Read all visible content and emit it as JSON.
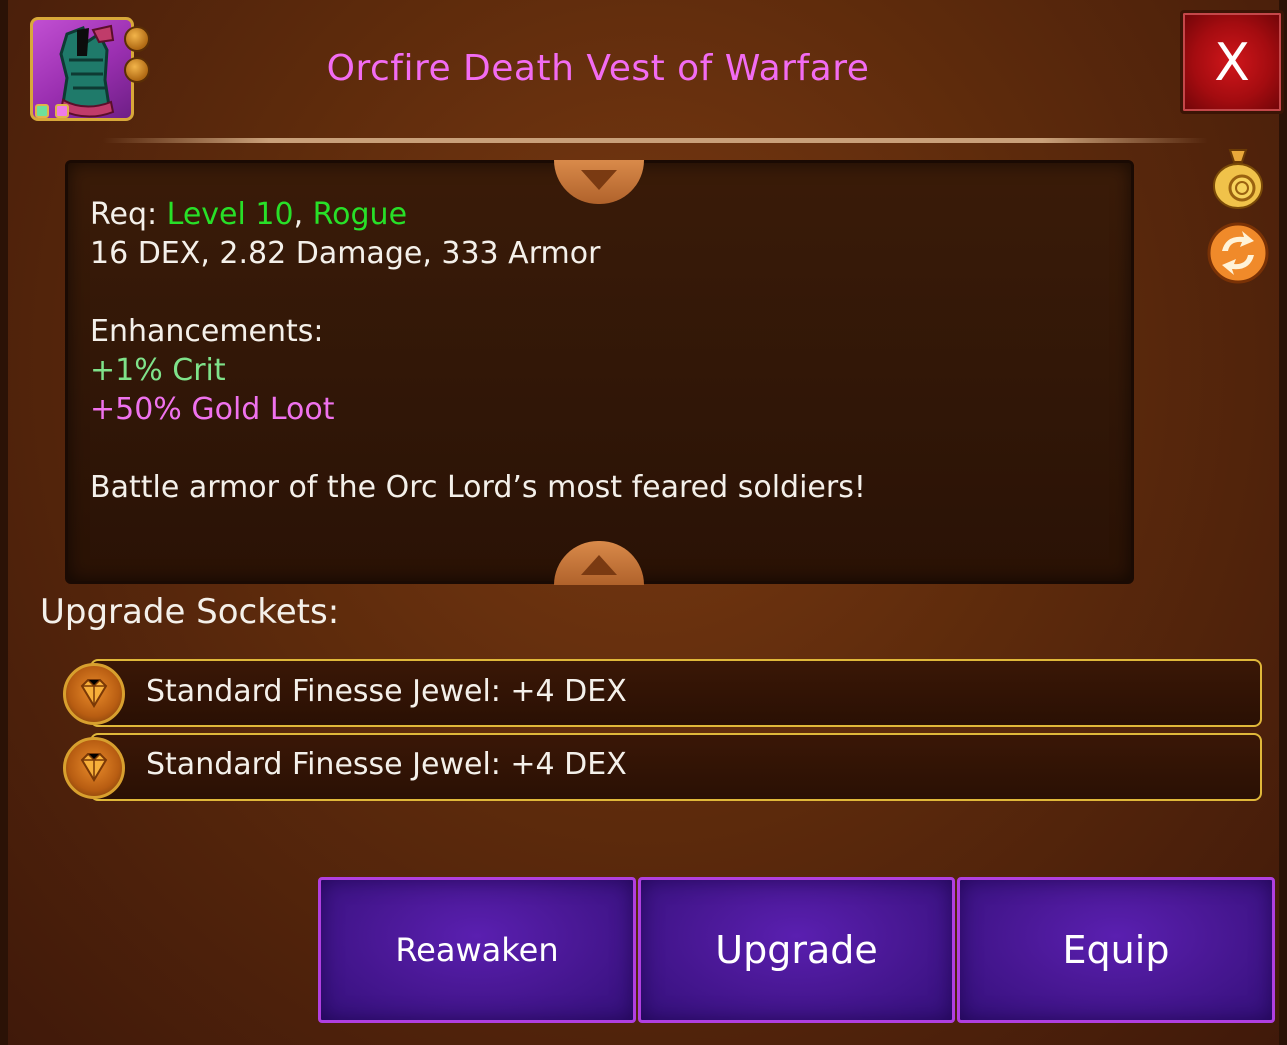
{
  "item": {
    "title": "Orcfire Death Vest of Warfare",
    "icon": "chest-armor-icon",
    "socket_indicators": 2,
    "gem_dot_colors": [
      "#6fe09a",
      "#ef7be8"
    ]
  },
  "close_label": "X",
  "side_icons": [
    "gold-bag-icon",
    "transfer-arrows-icon"
  ],
  "details": {
    "req_label": "Req:",
    "req_level": "Level 10",
    "req_sep": ",",
    "req_class": "Rogue",
    "stats": "16 DEX, 2.82 Damage, 333 Armor",
    "enh_heading": "Enhancements:",
    "enh_1": "+1% Crit",
    "enh_2": "+50% Gold Loot",
    "flavor": "Battle armor of the Orc Lord’s most feared soldiers!"
  },
  "sockets": {
    "heading": "Upgrade Sockets:",
    "items": [
      {
        "label": "Standard Finesse Jewel: +4 DEX"
      },
      {
        "label": "Standard Finesse Jewel: +4 DEX"
      }
    ]
  },
  "actions": {
    "reawaken": "Reawaken",
    "upgrade": "Upgrade",
    "equip": "Equip"
  },
  "colors": {
    "title": "#f26cf2",
    "requirement": "#28e028",
    "crit": "#7fe28a",
    "gold_loot": "#ef72ee",
    "button": "#4a1896",
    "button_border": "#b03fe0",
    "socket_border": "#e0b83a"
  }
}
